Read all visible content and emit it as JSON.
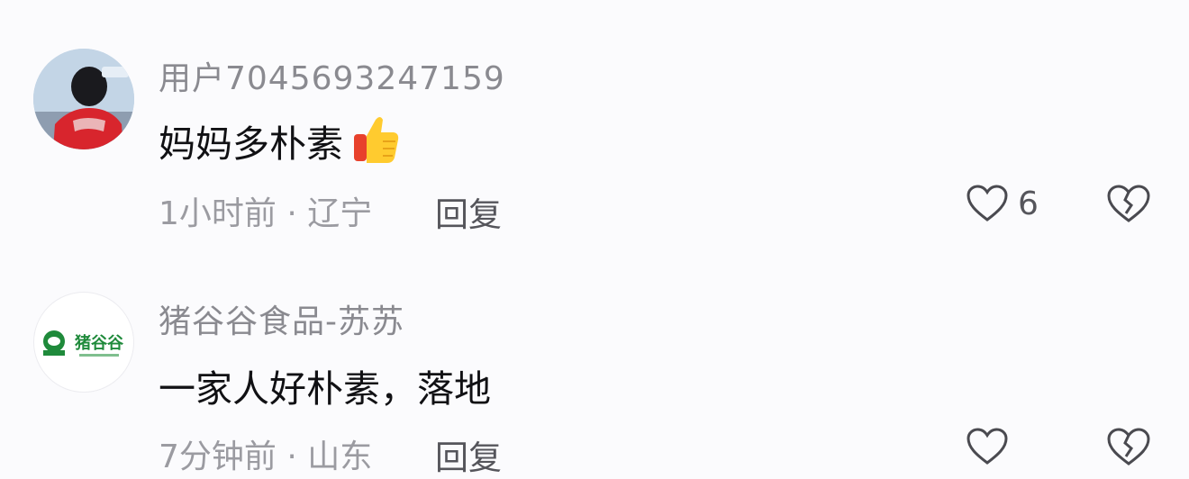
{
  "comments": [
    {
      "username": "用户7045693247159",
      "text": "妈妈多朴素",
      "emoji": "thumbs-up",
      "meta": "1小时前 · 辽宁",
      "reply_label": "回复",
      "like_count": "6"
    },
    {
      "username": "猪谷谷食品-苏苏",
      "text": "一家人好朴素，落地",
      "avatar_text": "猪谷谷",
      "meta": "7分钟前 · 山东",
      "reply_label": "回复"
    }
  ],
  "icons": {
    "like": "heart-outline-icon",
    "dislike": "broken-heart-icon",
    "thumbs_up": "thumbs-up-emoji"
  },
  "colors": {
    "background": "#fbfbfd",
    "username": "#8a8a90",
    "text": "#111114",
    "meta": "#9b9ba1",
    "logo_green": "#1f8a3b"
  }
}
